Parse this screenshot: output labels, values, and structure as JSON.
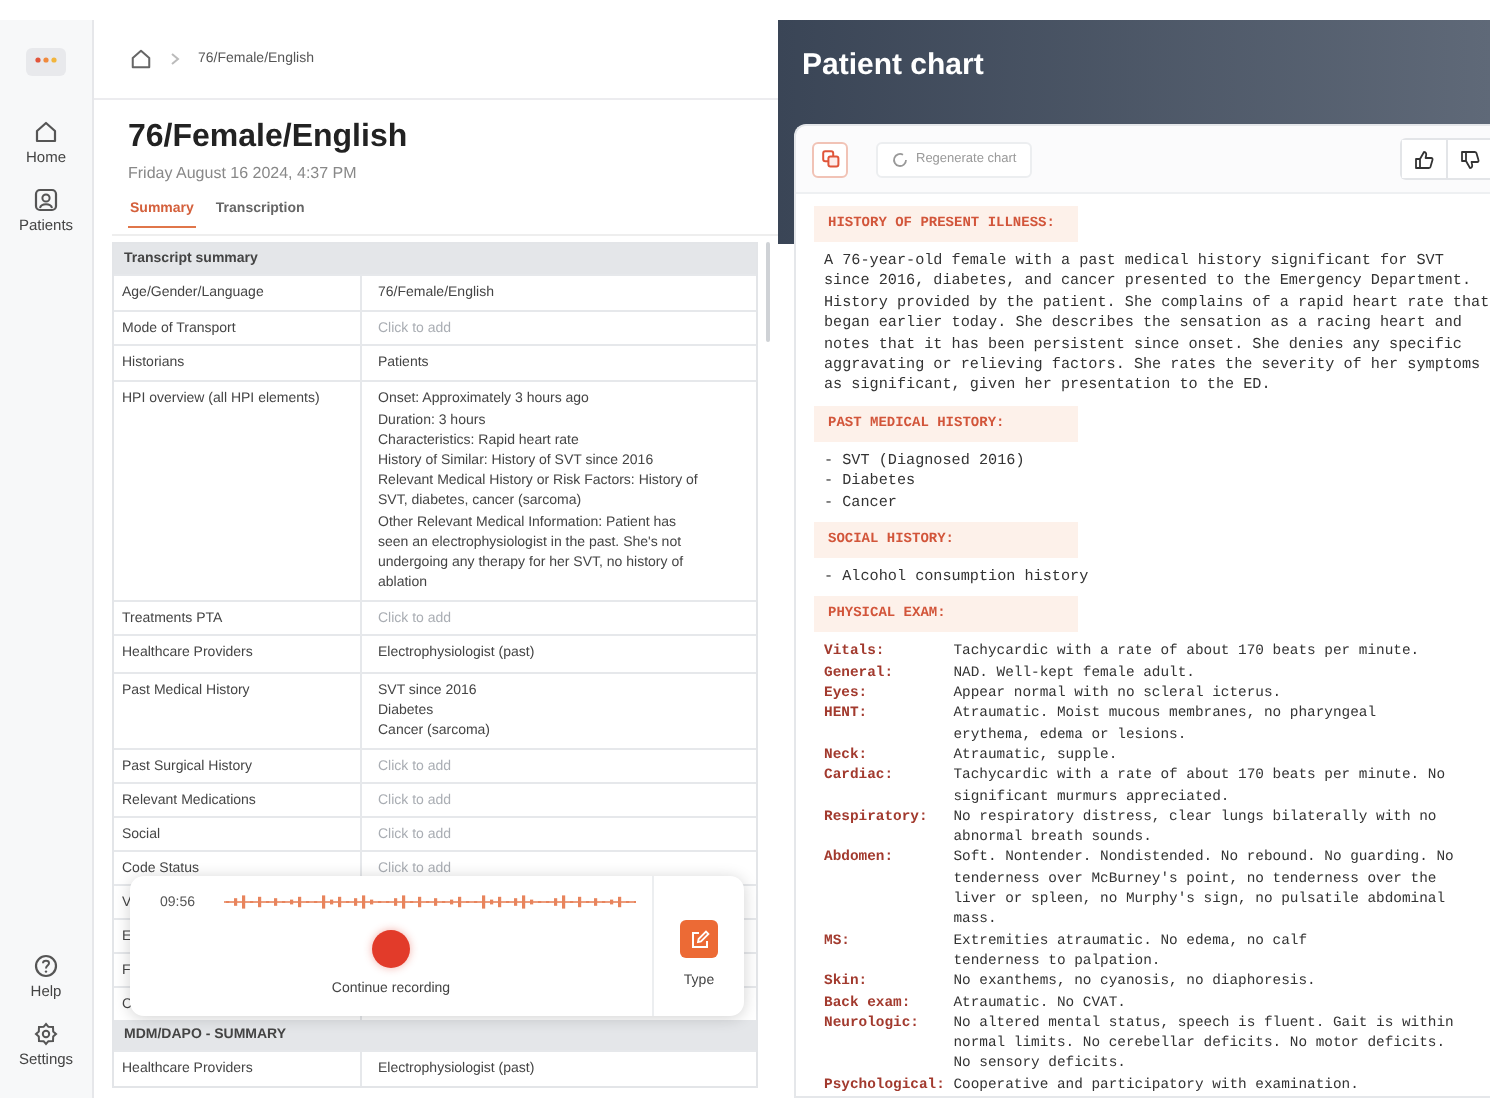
{
  "sidebar": {
    "logo": {
      "kind": "logo"
    },
    "nav": [
      {
        "kind": "home",
        "label": "Home"
      },
      {
        "kind": "patients",
        "label": "Patients"
      }
    ],
    "footer": [
      {
        "kind": "help",
        "label": "Help"
      },
      {
        "kind": "settings",
        "label": "Settings"
      }
    ]
  },
  "breadcrumb": {
    "current": "76/Female/English"
  },
  "header": {
    "title": "76/Female/English",
    "date": "Friday August 16 2024, 4:37 PM"
  },
  "tabs": [
    {
      "label": "Summary",
      "selected": true
    },
    {
      "label": "Transcription",
      "selected": false
    }
  ],
  "table": {
    "sections": [
      {
        "title": "Transcript summary",
        "rows": [
          {
            "label": "Age/Gender/Language",
            "lines": [
              "76/Female/English"
            ]
          },
          {
            "label": "Mode of Transport",
            "placeholder": "Click to add"
          },
          {
            "label": "Historians",
            "lines": [
              "Patients"
            ]
          },
          {
            "label": "HPI overview (all HPI elements)",
            "lines": [
              "Onset: Approximately 3 hours ago",
              "Duration: 3 hours",
              "Characteristics: Rapid heart rate",
              "History of Similar: History of SVT since 2016",
              "Relevant Medical History or Risk Factors: History of SVT, diabetes, cancer (sarcoma)",
              "Other Relevant Medical Information: Patient has seen an electrophysiologist in the past. She's not undergoing any therapy for her SVT, no history of ablation"
            ]
          },
          {
            "label": "Treatments PTA",
            "placeholder": "Click to add"
          },
          {
            "label": "Healthcare Providers",
            "lines": [
              "Electrophysiologist (past)"
            ]
          },
          {
            "label": "Past Medical History",
            "lines": [
              "SVT since 2016",
              "Diabetes",
              "Cancer (sarcoma)"
            ]
          },
          {
            "label": "Past Surgical History",
            "placeholder": "Click to add"
          },
          {
            "label": "Relevant Medications",
            "placeholder": "Click to add"
          },
          {
            "label": "Social",
            "placeholder": "Click to add"
          },
          {
            "label": "Code Status",
            "placeholder": "Click to add"
          },
          {
            "label": "V"
          },
          {
            "label": "E"
          },
          {
            "label": "F"
          },
          {
            "label": "C"
          }
        ]
      },
      {
        "title": "MDM/DAPO - SUMMARY",
        "rows": [
          {
            "label": "Healthcare Providers",
            "lines": [
              "Electrophysiologist (past)"
            ]
          }
        ]
      }
    ]
  },
  "recorder": {
    "time": "09:56",
    "label": "Continue recording",
    "type_label": "Type"
  },
  "chart": {
    "title": "Patient chart",
    "regenerate": "Regenerate chart",
    "sections": [
      {
        "heading": "HISTORY OF PRESENT ILLNESS:",
        "kind": "paragraph",
        "lines": [
          "A 76-year-old female with a past medical history significant for SVT",
          "since 2016, diabetes, and cancer presented to the Emergency Department.",
          "History provided by the patient. She complains of a rapid heart rate that",
          "began earlier today. She describes the sensation as a racing heart and",
          "notes that it has been persistent since onset. She denies any specific",
          "aggravating or relieving factors. She rates the severity of her symptoms",
          "as significant, given her presentation to the ED."
        ]
      },
      {
        "heading": "PAST MEDICAL HISTORY:",
        "kind": "paragraph",
        "lines": [
          "- SVT (Diagnosed 2016)",
          "- Diabetes",
          "- Cancer"
        ]
      },
      {
        "heading": "SOCIAL HISTORY:",
        "kind": "paragraph",
        "lines": [
          "- Alcohol consumption history"
        ]
      },
      {
        "heading": "PHYSICAL EXAM:",
        "kind": "pairs",
        "pairs": [
          {
            "label": "Vitals:",
            "lines": [
              "Tachycardic with a rate of about 170 beats per minute."
            ]
          },
          {
            "label": "General:",
            "lines": [
              "NAD. Well-kept female adult."
            ]
          },
          {
            "label": "Eyes:",
            "lines": [
              "Appear normal with no scleral icterus."
            ]
          },
          {
            "label": "HENT:",
            "lines": [
              "Atraumatic. Moist mucous membranes, no pharyngeal",
              "erythema, edema or lesions."
            ]
          },
          {
            "label": "Neck:",
            "lines": [
              "Atraumatic, supple."
            ]
          },
          {
            "label": "Cardiac:",
            "lines": [
              "Tachycardic with a rate of about 170 beats per minute. No",
              "significant murmurs appreciated."
            ]
          },
          {
            "label": "Respiratory:",
            "lines": [
              "No respiratory distress, clear lungs bilaterally with no",
              "abnormal breath sounds."
            ]
          },
          {
            "label": "Abdomen:",
            "lines": [
              "Soft. Nontender. Nondistended. No rebound. No guarding. No",
              "tenderness over McBurney's point, no tenderness over the",
              "liver or spleen, no Murphy's sign, no pulsatile abdominal",
              "mass."
            ]
          },
          {
            "label": "MS:",
            "lines": [
              "Extremities atraumatic. No edema, no calf",
              "tenderness to palpation."
            ]
          },
          {
            "label": "Skin:",
            "lines": [
              "No exanthems, no cyanosis, no diaphoresis."
            ]
          },
          {
            "label": "Back exam:",
            "lines": [
              "Atraumatic. No CVAT."
            ]
          },
          {
            "label": "Neurologic:",
            "lines": [
              "No altered mental status, speech is fluent. Gait is within",
              "normal limits. No cerebellar deficits. No motor deficits.",
              "No sensory deficits."
            ]
          },
          {
            "label": "Psychological:",
            "lines": [
              "Cooperative and participatory with examination."
            ]
          }
        ]
      }
    ]
  }
}
